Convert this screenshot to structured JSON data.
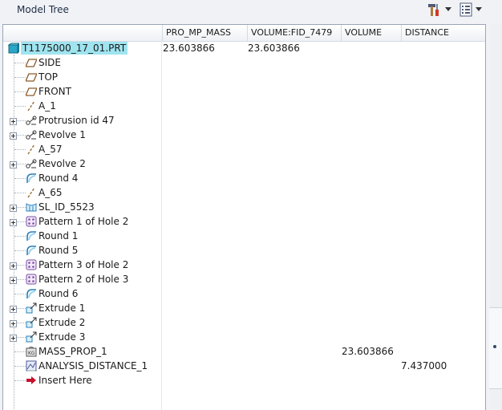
{
  "panel": {
    "title": "Model Tree"
  },
  "toolbar": {
    "tools_icon": "hammer-screwdriver-icon",
    "settings_icon": "tree-settings-icon",
    "dropdown_icon": "chevron-down-icon"
  },
  "columns": [
    "",
    "PRO_MP_MASS",
    "VOLUME:FID_7479",
    "VOLUME",
    "DISTANCE"
  ],
  "rows": [
    {
      "label": "T1175000_17_01.PRT",
      "icon": "part-icon",
      "expandable": false,
      "root": true,
      "mass": "23.603866",
      "volume_fid": "23.603866",
      "volume": "",
      "distance": ""
    },
    {
      "label": "SIDE",
      "icon": "datum-plane-icon",
      "expandable": false
    },
    {
      "label": "TOP",
      "icon": "datum-plane-icon",
      "expandable": false
    },
    {
      "label": "FRONT",
      "icon": "datum-plane-icon",
      "expandable": false
    },
    {
      "label": "A_1",
      "icon": "datum-axis-icon",
      "expandable": false
    },
    {
      "label": "Protrusion id 47",
      "icon": "protrusion-icon",
      "expandable": true
    },
    {
      "label": "Revolve 1",
      "icon": "revolve-icon",
      "expandable": true
    },
    {
      "label": "A_57",
      "icon": "datum-axis-icon",
      "expandable": false
    },
    {
      "label": "Revolve 2",
      "icon": "revolve-icon",
      "expandable": true
    },
    {
      "label": "Round 4",
      "icon": "round-icon",
      "expandable": false
    },
    {
      "label": "A_65",
      "icon": "datum-axis-icon",
      "expandable": false
    },
    {
      "label": "SL_ID_5523",
      "icon": "surface-icon",
      "expandable": true
    },
    {
      "label": "Pattern 1 of Hole 2",
      "icon": "pattern-icon",
      "expandable": true
    },
    {
      "label": "Round 1",
      "icon": "round-icon",
      "expandable": false
    },
    {
      "label": "Round 5",
      "icon": "round-icon",
      "expandable": false
    },
    {
      "label": "Pattern 3 of Hole 2",
      "icon": "pattern-icon",
      "expandable": true
    },
    {
      "label": "Pattern 2 of Hole 3",
      "icon": "pattern-icon",
      "expandable": true
    },
    {
      "label": "Round 6",
      "icon": "round-icon",
      "expandable": false
    },
    {
      "label": "Extrude 1",
      "icon": "extrude-icon",
      "expandable": true
    },
    {
      "label": "Extrude 2",
      "icon": "extrude-icon",
      "expandable": true
    },
    {
      "label": "Extrude 3",
      "icon": "extrude-icon",
      "expandable": true
    },
    {
      "label": "MASS_PROP_1",
      "icon": "mass-prop-icon",
      "expandable": false,
      "volume": "23.603866"
    },
    {
      "label": "ANALYSIS_DISTANCE_1",
      "icon": "analysis-distance-icon",
      "expandable": false,
      "distance": "7.437000"
    },
    {
      "label": "Insert Here",
      "icon": "insert-here-arrow-icon",
      "expandable": false
    }
  ],
  "colors": {
    "selection": "#9fe4ef",
    "border": "#9aa6b6",
    "accent_red": "#c8102e"
  }
}
